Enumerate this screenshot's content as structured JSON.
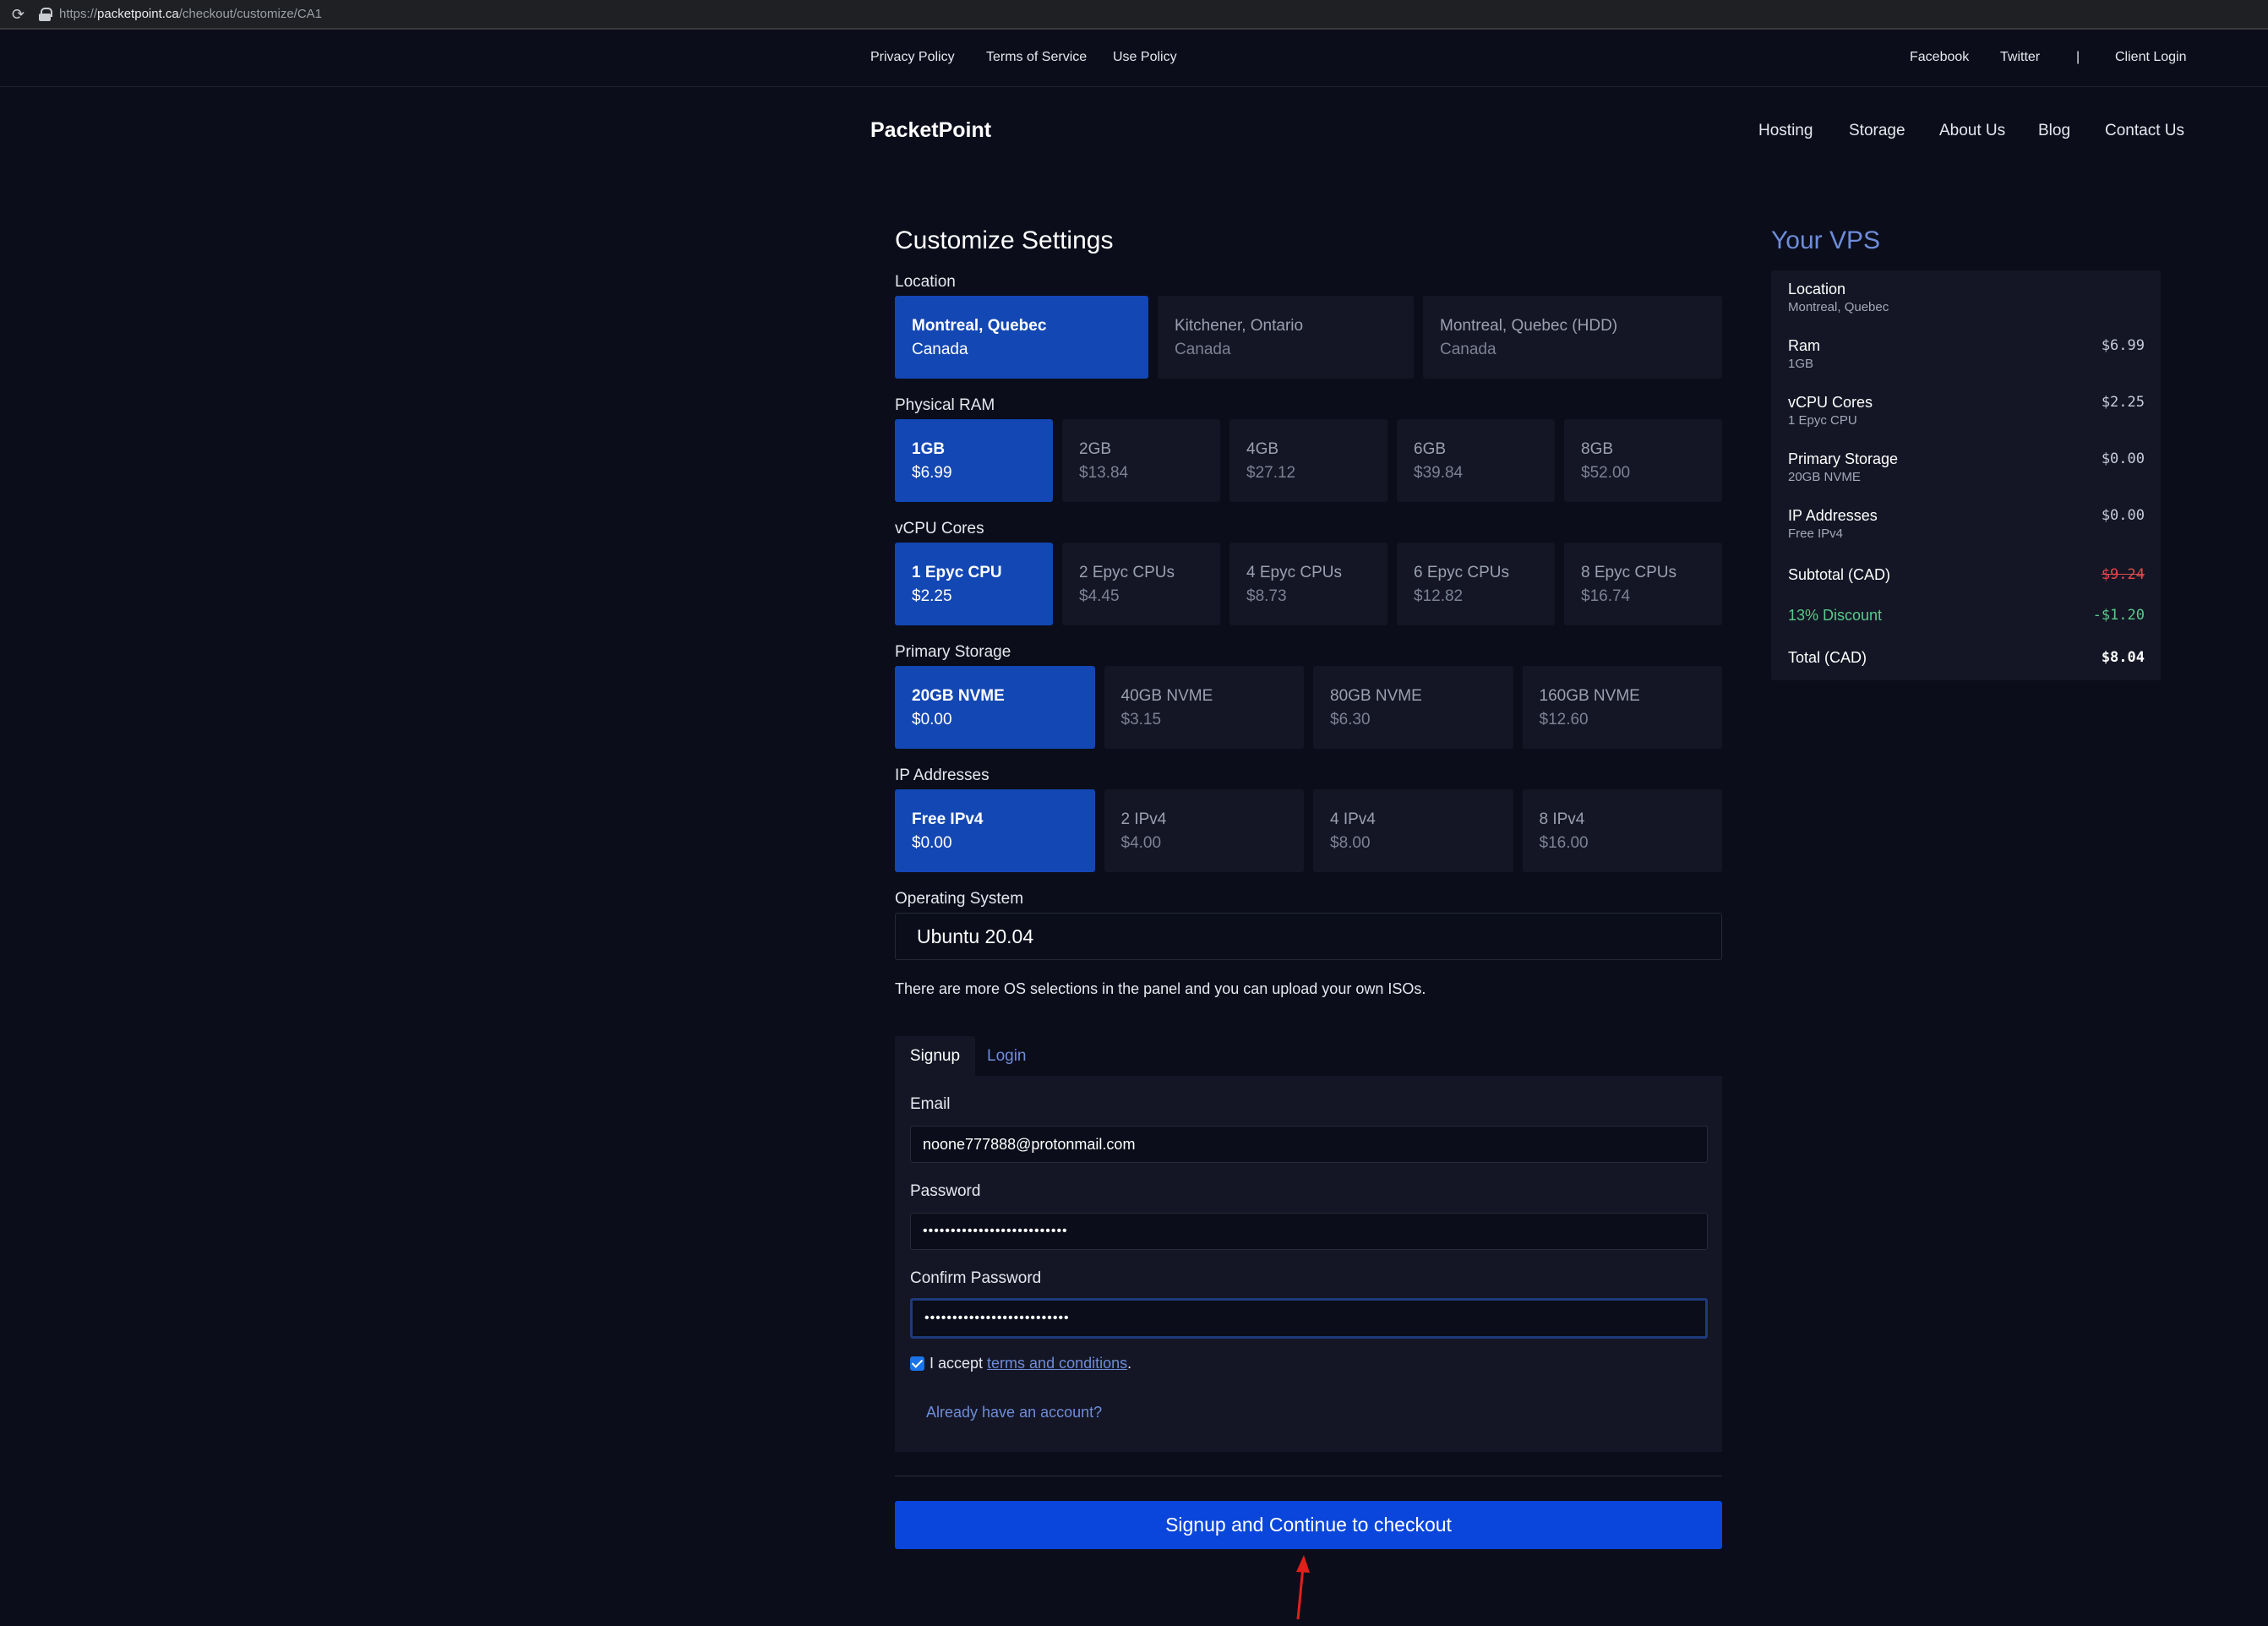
{
  "browser": {
    "url_prefix": "https://",
    "url_host": "packetpoint.ca",
    "url_path": "/checkout/customize/CA1"
  },
  "topnav": {
    "privacy": "Privacy Policy",
    "terms": "Terms of Service",
    "use": "Use Policy",
    "facebook": "Facebook",
    "twitter": "Twitter",
    "separator": "|",
    "client_login": "Client Login"
  },
  "header": {
    "brand": "PacketPoint",
    "nav": [
      "Hosting",
      "Storage",
      "About Us",
      "Blog",
      "Contact Us"
    ]
  },
  "customize": {
    "title": "Customize Settings",
    "location": {
      "label": "Location",
      "options": [
        {
          "title": "Montreal, Quebec",
          "sub": "Canada"
        },
        {
          "title": "Kitchener, Ontario",
          "sub": "Canada"
        },
        {
          "title": "Montreal, Quebec (HDD)",
          "sub": "Canada"
        }
      ],
      "selected": 0
    },
    "ram": {
      "label": "Physical RAM",
      "options": [
        {
          "title": "1GB",
          "sub": "$6.99"
        },
        {
          "title": "2GB",
          "sub": "$13.84"
        },
        {
          "title": "4GB",
          "sub": "$27.12"
        },
        {
          "title": "6GB",
          "sub": "$39.84"
        },
        {
          "title": "8GB",
          "sub": "$52.00"
        }
      ],
      "selected": 0
    },
    "vcpu": {
      "label": "vCPU Cores",
      "options": [
        {
          "title": "1 Epyc CPU",
          "sub": "$2.25"
        },
        {
          "title": "2 Epyc CPUs",
          "sub": "$4.45"
        },
        {
          "title": "4 Epyc CPUs",
          "sub": "$8.73"
        },
        {
          "title": "6 Epyc CPUs",
          "sub": "$12.82"
        },
        {
          "title": "8 Epyc CPUs",
          "sub": "$16.74"
        }
      ],
      "selected": 0
    },
    "storage": {
      "label": "Primary Storage",
      "options": [
        {
          "title": "20GB NVME",
          "sub": "$0.00"
        },
        {
          "title": "40GB NVME",
          "sub": "$3.15"
        },
        {
          "title": "80GB NVME",
          "sub": "$6.30"
        },
        {
          "title": "160GB NVME",
          "sub": "$12.60"
        }
      ],
      "selected": 0
    },
    "ip": {
      "label": "IP Addresses",
      "options": [
        {
          "title": "Free IPv4",
          "sub": "$0.00"
        },
        {
          "title": "2 IPv4",
          "sub": "$4.00"
        },
        {
          "title": "4 IPv4",
          "sub": "$8.00"
        },
        {
          "title": "8 IPv4",
          "sub": "$16.00"
        }
      ],
      "selected": 0
    },
    "os": {
      "label": "Operating System",
      "value": "Ubuntu 20.04",
      "note": "There are more OS selections in the panel and you can upload your own ISOs."
    }
  },
  "account": {
    "tab_signup": "Signup",
    "tab_login": "Login",
    "email_label": "Email",
    "email_value": "noone777888@protonmail.com",
    "password_label": "Password",
    "password_value": "••••••••••••••••••••••••••",
    "confirm_label": "Confirm Password",
    "confirm_value": "••••••••••••••••••••••••••",
    "accept_prefix": "I accept",
    "accept_link": "terms and conditions",
    "accept_suffix": ".",
    "already": "Already have an account?",
    "submit": "Signup and Continue to checkout"
  },
  "summary": {
    "title": "Your VPS",
    "rows": [
      {
        "name": "Location",
        "sub": "Montreal, Quebec",
        "price": ""
      },
      {
        "name": "Ram",
        "sub": "1GB",
        "price": "$6.99"
      },
      {
        "name": "vCPU Cores",
        "sub": "1 Epyc CPU",
        "price": "$2.25"
      },
      {
        "name": "Primary Storage",
        "sub": "20GB NVME",
        "price": "$0.00"
      },
      {
        "name": "IP Addresses",
        "sub": "Free IPv4",
        "price": "$0.00"
      }
    ],
    "subtotal_label": "Subtotal (CAD)",
    "subtotal_value": "$9.24",
    "discount_label": "13% Discount",
    "discount_value": "-$1.20",
    "total_label": "Total (CAD)",
    "total_value": "$8.04"
  },
  "colors": {
    "background": "#0b0d1a",
    "selected_option": "#1347b3",
    "cta": "#0a46db",
    "link": "#6e8cd9",
    "annotation_arrow": "#e0201a"
  }
}
